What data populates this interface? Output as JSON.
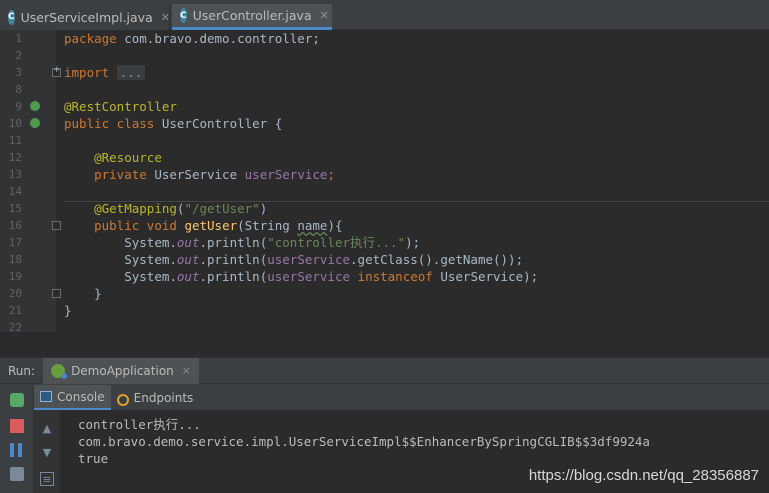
{
  "tabs": [
    {
      "icon": "C",
      "label": "UserServiceImpl.java",
      "active": false
    },
    {
      "icon": "C",
      "label": "UserController.java",
      "active": true
    }
  ],
  "editor": {
    "line_numbers": [
      "1",
      "2",
      "3",
      "8",
      "9",
      "10",
      "11",
      "12",
      "13",
      "14",
      "15",
      "16",
      "17",
      "18",
      "19",
      "20",
      "21",
      "22"
    ],
    "code": {
      "pkg_kw": "package",
      "pkg_name": " com.bravo.demo.controller;",
      "import_kw": "import",
      "import_fold": "...",
      "rest_ann": "@RestController",
      "cls_kw": "public class",
      "cls_name": " UserController {",
      "res_ann": "@Resource",
      "priv_kw": "private",
      "svc_type": " UserService ",
      "svc_field": "userService",
      "semi": ";",
      "get_ann": "@GetMapping",
      "get_open": "(",
      "get_path": "\"/getUser\"",
      "get_close": ")",
      "pub_void": "public void",
      "method_name": "getUser",
      "param_type": "(String ",
      "param_name": "name",
      "param_close": "){",
      "sys": "System.",
      "out": "out",
      "println": ".println(",
      "line17_str": "\"controller执行...\"",
      "line17_end": ");",
      "line18_field": "userService",
      "line18_mid": ".getClass().getName());",
      "line19_field": "userService",
      "instanceof_kw": " instanceof",
      "line19_end": " UserService);",
      "close_method": "}",
      "close_class": "}"
    }
  },
  "run": {
    "label": "Run:",
    "config": "DemoApplication",
    "config_close": "×",
    "subtabs": [
      "Console",
      "Endpoints"
    ],
    "console_lines": [
      "controller执行...",
      "com.bravo.demo.service.impl.UserServiceImpl$$EnhancerBySpringCGLIB$$3df9924a",
      "true"
    ],
    "watermark": "https://blog.csdn.net/qq_28356887"
  },
  "colors": {
    "keyword": "#cc7832",
    "annotation": "#bbb529",
    "string": "#6a8759",
    "field": "#9876aa",
    "method": "#ffc66d"
  }
}
